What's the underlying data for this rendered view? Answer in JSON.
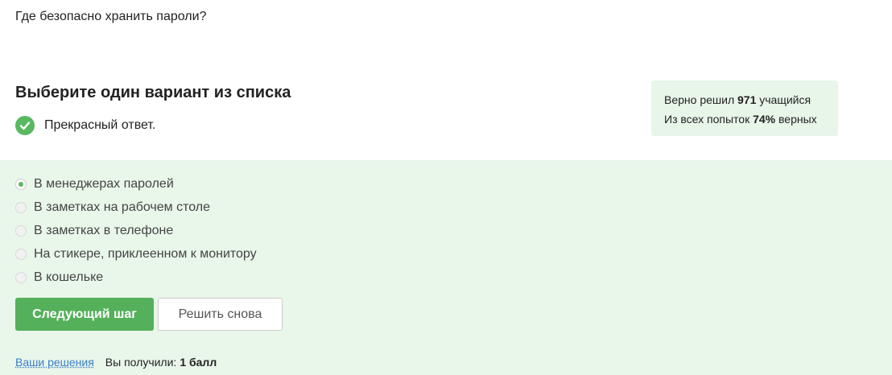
{
  "question": "Где безопасно хранить пароли?",
  "heading": "Выберите один вариант из списка",
  "feedback": {
    "icon": "check-circle-icon",
    "icon_color": "#59b960",
    "text": "Прекрасный ответ."
  },
  "stats": {
    "solved_prefix": "Верно решил",
    "solved_count": "971",
    "solved_suffix": "учащийся",
    "attempts_prefix": "Из всех попыток",
    "attempts_percent": "74%",
    "attempts_suffix": "верных",
    "background": "#e8f5e9"
  },
  "options": [
    {
      "label": "В менеджерах паролей",
      "selected": true
    },
    {
      "label": "В заметках на рабочем столе",
      "selected": false
    },
    {
      "label": "В заметках в телефоне",
      "selected": false
    },
    {
      "label": "На стикере, приклеенном к монитору",
      "selected": false
    },
    {
      "label": "В кошельке",
      "selected": false
    }
  ],
  "buttons": {
    "next": "Следующий шаг",
    "retry": "Решить снова"
  },
  "footer": {
    "solutions_link": "Ваши решения",
    "score_prefix": "Вы получили:",
    "score_value": "1 балл"
  },
  "colors": {
    "accent": "#54b05a",
    "answer_background": "#e9f6ea",
    "link": "#3a7ec6"
  }
}
